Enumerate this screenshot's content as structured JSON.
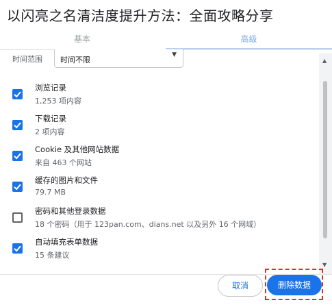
{
  "overlay": {
    "headline": "以闪亮之名清洁度提升方法：全面攻略分享"
  },
  "tabs": [
    {
      "label": "基本"
    },
    {
      "label": "高级"
    }
  ],
  "time_range": {
    "label": "时间范围",
    "value": "时间不限"
  },
  "items": [
    {
      "title": "浏览记录",
      "subtitle": "1,253 项内容",
      "checked": true
    },
    {
      "title": "下载记录",
      "subtitle": "2 项内容",
      "checked": true
    },
    {
      "title": "Cookie 及其他网站数据",
      "subtitle": "来自 463 个网站",
      "checked": true
    },
    {
      "title": "缓存的图片和文件",
      "subtitle": "79.7 MB",
      "checked": true
    },
    {
      "title": "密码和其他登录数据",
      "subtitle": "18 个密码（用于 123pan.com、dians.net 以及另外 16 个网域）",
      "checked": false
    },
    {
      "title": "自动填充表单数据",
      "subtitle": "15 条建议",
      "checked": true
    }
  ],
  "footer": {
    "cancel_label": "取消",
    "delete_label": "删除数据"
  },
  "colors": {
    "accent": "#1a73e8",
    "highlight": "#d93025"
  }
}
